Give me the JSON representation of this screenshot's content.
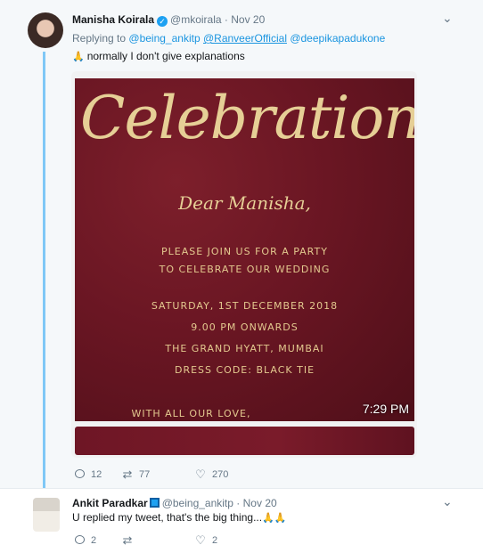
{
  "tweet1": {
    "name": "Manisha Koirala",
    "handle": "@mkoirala",
    "separator": "·",
    "date": "Nov 20",
    "replying_prefix": "Replying to",
    "mentions": [
      "@being_ankitp",
      "@RanveerOfficial",
      "@deepikapadukone"
    ],
    "emoji": "🙏",
    "text": "normally I don't give explanations",
    "media": {
      "title": "Celebration",
      "greeting": "Dear Manisha,",
      "lines": [
        "PLEASE JOIN US FOR A PARTY",
        "TO CELEBRATE OUR WEDDING",
        "SATURDAY, 1ST DECEMBER 2018",
        "9.00 PM ONWARDS",
        "THE GRAND HYATT, MUMBAI",
        "DRESS CODE: BLACK TIE",
        "WITH ALL OUR LOVE,"
      ],
      "video_time": "7:29 PM"
    },
    "actions": {
      "replies": "12",
      "retweets": "77",
      "likes": "270"
    }
  },
  "tweet2": {
    "name": "Ankit Paradkar",
    "handle": "@being_ankitp",
    "separator": "·",
    "date": "Nov 20",
    "text": "U replied my tweet, that's the big thing...",
    "emoji": "🙏🙏",
    "actions": {
      "replies": "2",
      "retweets": "",
      "likes": "2"
    }
  },
  "colors": {
    "link": "#1b95e0",
    "verified": "#1da1f2",
    "card_bg": "#6a1623",
    "card_gold": "#e6cf96"
  },
  "icons": [
    "verified-badge-icon",
    "chevron-down-icon",
    "reply-icon",
    "retweet-icon",
    "like-icon"
  ]
}
